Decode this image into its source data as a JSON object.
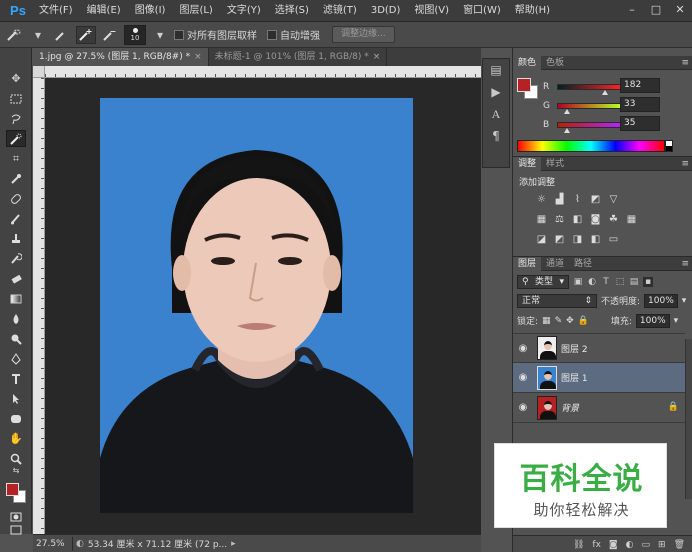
{
  "app": {
    "logo": "Ps"
  },
  "menu": [
    "文件(F)",
    "编辑(E)",
    "图像(I)",
    "图层(L)",
    "文字(Y)",
    "选择(S)",
    "滤镜(T)",
    "3D(D)",
    "视图(V)",
    "窗口(W)",
    "帮助(H)"
  ],
  "window_controls": {
    "minimize": "–",
    "restore": "□",
    "close": "✕"
  },
  "options": {
    "brush_size": "10",
    "sample_all_layers": "对所有图层取样",
    "auto_enhance": "自动增强",
    "refine_edge": "调整边缘..."
  },
  "tabs": [
    {
      "label": "1.jpg @ 27.5% (图层 1, RGB/8#) *",
      "close": "×"
    },
    {
      "label": "未标题-1 @ 101% (图层 1, RGB/8) *",
      "close": "×"
    }
  ],
  "colors": {
    "foreground": "#b62123",
    "background": "#ffffff",
    "photo_bg": "#3a82cd"
  },
  "color_panel": {
    "tabs": [
      "颜色",
      "色板"
    ],
    "R": {
      "label": "R",
      "value": "182"
    },
    "G": {
      "label": "G",
      "value": "33"
    },
    "B": {
      "label": "B",
      "value": "35"
    }
  },
  "adjustments": {
    "tabs": [
      "调整",
      "样式"
    ],
    "title": "添加调整"
  },
  "layers": {
    "tabs": [
      "图层",
      "通道",
      "路径"
    ],
    "filter_kind": "类型",
    "blend_mode": "正常",
    "opacity_label": "不透明度:",
    "opacity_value": "100%",
    "lock_label": "锁定:",
    "fill_label": "填充:",
    "fill_value": "100%",
    "items": [
      {
        "name": "图层 2"
      },
      {
        "name": "图层 1"
      },
      {
        "name": "背景"
      }
    ]
  },
  "status": {
    "zoom": "27.5%",
    "doc_info": "53.34 厘米 x 71.12 厘米 (72 p..."
  },
  "watermark": {
    "main": "百科全说",
    "sub": "助你轻松解决"
  }
}
